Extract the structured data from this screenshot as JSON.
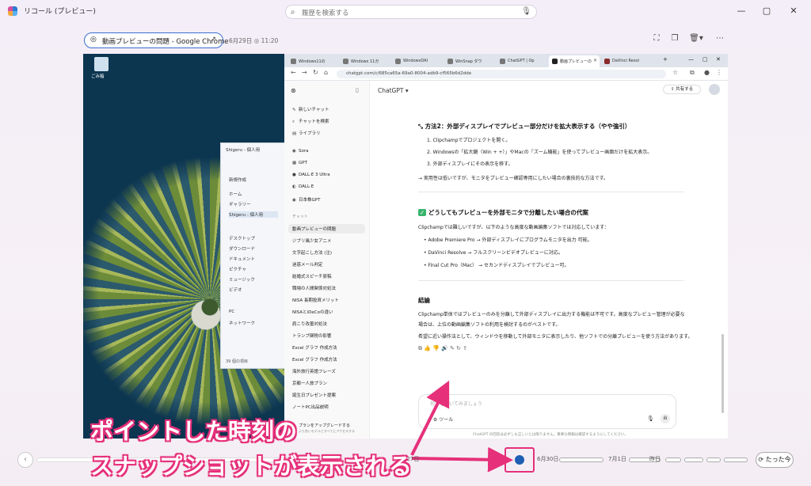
{
  "app": {
    "title": "リコール (プレビュー)",
    "search_placeholder": "履歴を検索する",
    "window_controls": [
      "—",
      "▢",
      "✕"
    ]
  },
  "snapshot": {
    "chip_label": "動画プレビューの問題 - Google Chrome",
    "date": "6月29日 ◎ 11:20"
  },
  "desktop": {
    "recycle_label": "ごみ箱"
  },
  "explorer": {
    "title": "Shigeru - 個人用",
    "new_label": "新規作成",
    "rows": [
      "ホーム",
      "ギャラリー",
      "Shigeru - 個人用",
      "デスクトップ",
      "ダウンロード",
      "ドキュメント",
      "ピクチャ",
      "ミュージック",
      "ビデオ",
      "PC",
      "ネットワーク"
    ],
    "status": "39 個の項目"
  },
  "browser": {
    "tabs": [
      "Windows11の",
      "Windows 11ガ",
      "WindowsDAI",
      "WinSnap ダウ",
      "ChatGPT | Op",
      "動画プレビューの",
      "DaVinci Resol"
    ],
    "url": "chatgpt.com/c/685ca65a-69a0-8004-adb9-cf565b6d2dde"
  },
  "chatgpt": {
    "model": "ChatGPT",
    "share": "共有する",
    "side_top": [
      "新しいチャット",
      "チャットを検索",
      "ライブラリ"
    ],
    "side_gpts": [
      "Sora",
      "GPT",
      "DALL·E 3 Ultra",
      "DALL·E",
      "日本株GPT"
    ],
    "section_label": "チャット",
    "chats": [
      "動画プレビューの問題",
      "ジブリ風少女アニメ",
      "文字起こし方法 (注)",
      "迷惑メール判定",
      "結婚式スピーチ原稿",
      "職場の人間関係対処法",
      "NISA 長期投資メリット",
      "NISAとiDeCoの違い",
      "肩こり改善対処法",
      "トランプ関税の影響",
      "Excel グラフ 作成方法",
      "Excel グラフ 作成方法",
      "海外旅行英語フレーズ",
      "京都一人旅プラン",
      "誕生日プレゼント提案",
      "ノートPC出品説明"
    ],
    "upgrade": "プランをアップグレードする",
    "upgrade_sub": "より良いモデルとすべてにアクセスする",
    "method2_title": "方法2：外部ディスプレイでプレビュー部分だけを拡大表示する（やや強引）",
    "method2_steps": [
      "1.  Clipchampでプロジェクトを開く。",
      "2.  Windowsの「拡大鏡（Win + +）」やMacの「ズーム機能」を使ってプレビュー画面だけを拡大表示。",
      "3.  外部ディスプレイにその表示を移す。"
    ],
    "method2_note": "→ 実用性は低いですが、モニタをプレビュー確認専用にしたい場合の裏技的な方法です。",
    "sep_title": "どうしてもプレビューを外部モニタで分離したい場合の代案",
    "sep_intro": "Clipchampでは難しいですが、以下のような高度な動画編集ソフトでは対応しています：",
    "sep_items": [
      "Adobe Premiere Pro → 外部ディスプレイにプログラムモニタを出力 可能。",
      "DaVinci Resolve → フルスクリーンビデオプレビューに対応。",
      "Final Cut Pro（Mac） → セカンドディスプレイでプレビュー可。"
    ],
    "conclusion_title": "結論",
    "conclusion_1": "Clipchamp単体ではプレビューのみを分離して外部ディスプレイに出力する機能は不可です。高度なプレビュー管理が必要な",
    "conclusion_2": "場合は、上位の動画編集ソフトの利用を検討するのがベストです。",
    "conclusion_3": "希望に近い操作法として、ウィンドウを移動して外部モニタに表示したり、他ソフトでの分離プレビューを使う方法があります。",
    "input_placeholder": "何でも聞いてみましょう",
    "tool_label": "ツール",
    "footer": "ChatGPT の回答は必ずしも正しいとは限りません。重要な情報は確認するようにしてください。"
  },
  "timeline": {
    "labels": [
      "6月27日",
      "6月30日",
      "7月1日",
      "昨日"
    ],
    "now": "たった今"
  },
  "annotation": {
    "line1": "ポイントした時刻の",
    "line2": "スナップショットが表示される"
  }
}
